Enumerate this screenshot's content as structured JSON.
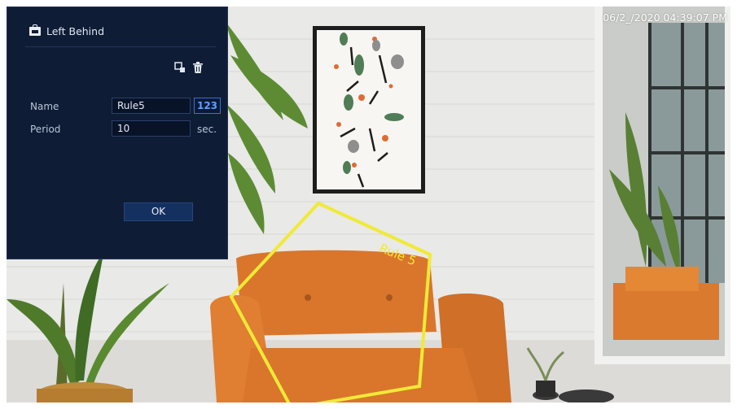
{
  "panel": {
    "title": "Left Behind",
    "icons": [
      "briefcase-icon",
      "draw-region-icon",
      "trash-icon"
    ]
  },
  "form": {
    "name_label": "Name",
    "name_value": "Rule5",
    "keyboard_button": "123",
    "period_label": "Period",
    "period_value": "10",
    "period_unit": "sec.",
    "ok_label": "OK"
  },
  "overlay": {
    "timestamp": "06/2_/2020 04:39:07 PM",
    "rule_label": "Rule 5"
  },
  "colors": {
    "panel_bg": "#0f1c35",
    "rule_yellow": "#f0ea36",
    "sofa_orange": "#d9762c",
    "keyboard_badge_blue": "#3d6fcf"
  }
}
